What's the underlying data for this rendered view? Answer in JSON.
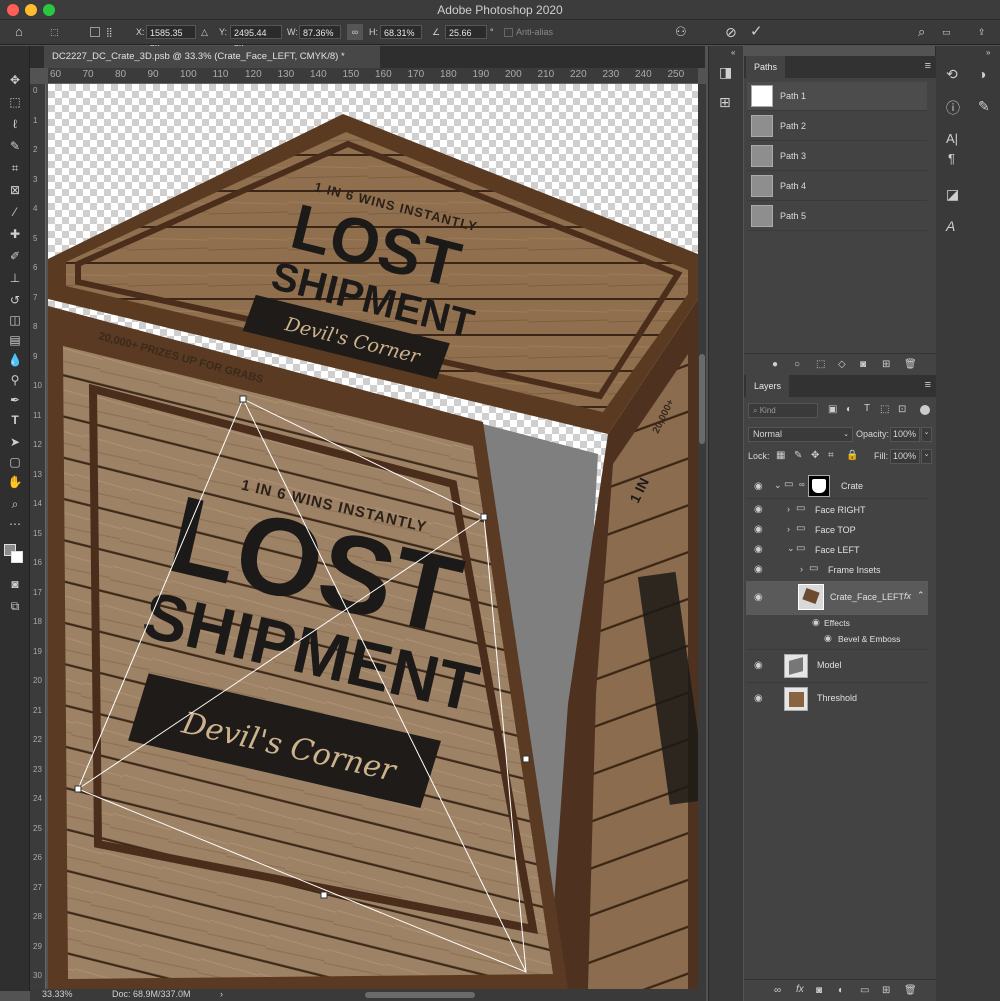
{
  "app": {
    "title": "Adobe Photoshop 2020"
  },
  "options_bar": {
    "x_label": "X:",
    "x_value": "1585.35 px",
    "y_label": "Y:",
    "y_value": "2495.44 px",
    "w_label": "W:",
    "w_value": "87.36%",
    "h_label": "H:",
    "h_value": "68.31%",
    "angle_value": "25.66",
    "angle_unit": "°",
    "antialias_label": "Anti-alias"
  },
  "document": {
    "tab_title": "DC2227_DC_Crate_3D.psb @ 33.3% (Crate_Face_LEFT, CMYK/8) *"
  },
  "ruler": {
    "h_ticks": [
      "60",
      "70",
      "80",
      "90",
      "100",
      "110",
      "120",
      "130",
      "140",
      "150",
      "160",
      "170",
      "180",
      "190",
      "200",
      "210",
      "220",
      "230",
      "240",
      "250"
    ],
    "v_ticks": [
      "0",
      "1",
      "2",
      "3",
      "4",
      "5",
      "6",
      "7",
      "8",
      "9",
      "10",
      "11",
      "12",
      "13",
      "14",
      "15",
      "16",
      "17",
      "18",
      "19",
      "20",
      "21",
      "22",
      "23",
      "24",
      "25",
      "26",
      "27",
      "28",
      "29",
      "30"
    ]
  },
  "status": {
    "zoom": "33.33%",
    "doc": "Doc: 68.9M/337.0M"
  },
  "artwork": {
    "line1": "1 IN 6 WINS INSTANTLY",
    "title1": "LOST",
    "title2": "SHIPMENT",
    "tagline": "Devil's Corner",
    "banner": "20,000+ PRIZES UP FOR GRABS",
    "side_line1": "1 IN",
    "side_banner": "20,000+"
  },
  "paths_panel": {
    "tab": "Paths",
    "items": [
      "Path 1",
      "Path 2",
      "Path 3",
      "Path 4",
      "Path 5"
    ]
  },
  "layers_panel": {
    "tab": "Layers",
    "filter_placeholder": "Kind",
    "blend_mode": "Normal",
    "opacity_label": "Opacity:",
    "opacity_value": "100%",
    "lock_label": "Lock:",
    "fill_label": "Fill:",
    "fill_value": "100%",
    "layers": {
      "crate": "Crate",
      "face_right": "Face RIGHT",
      "face_top": "Face TOP",
      "face_left": "Face LEFT",
      "frame_insets": "Frame Insets",
      "crate_face_left": "Crate_Face_LEFT",
      "fx": "fx",
      "effects": "Effects",
      "bevel": "Bevel & Emboss",
      "model": "Model",
      "threshold": "Threshold"
    }
  },
  "colors": {
    "accent": "#2d6fd6",
    "wood_dark": "#5a3a22",
    "wood_light": "#a88763",
    "ink": "#1c1a18"
  }
}
